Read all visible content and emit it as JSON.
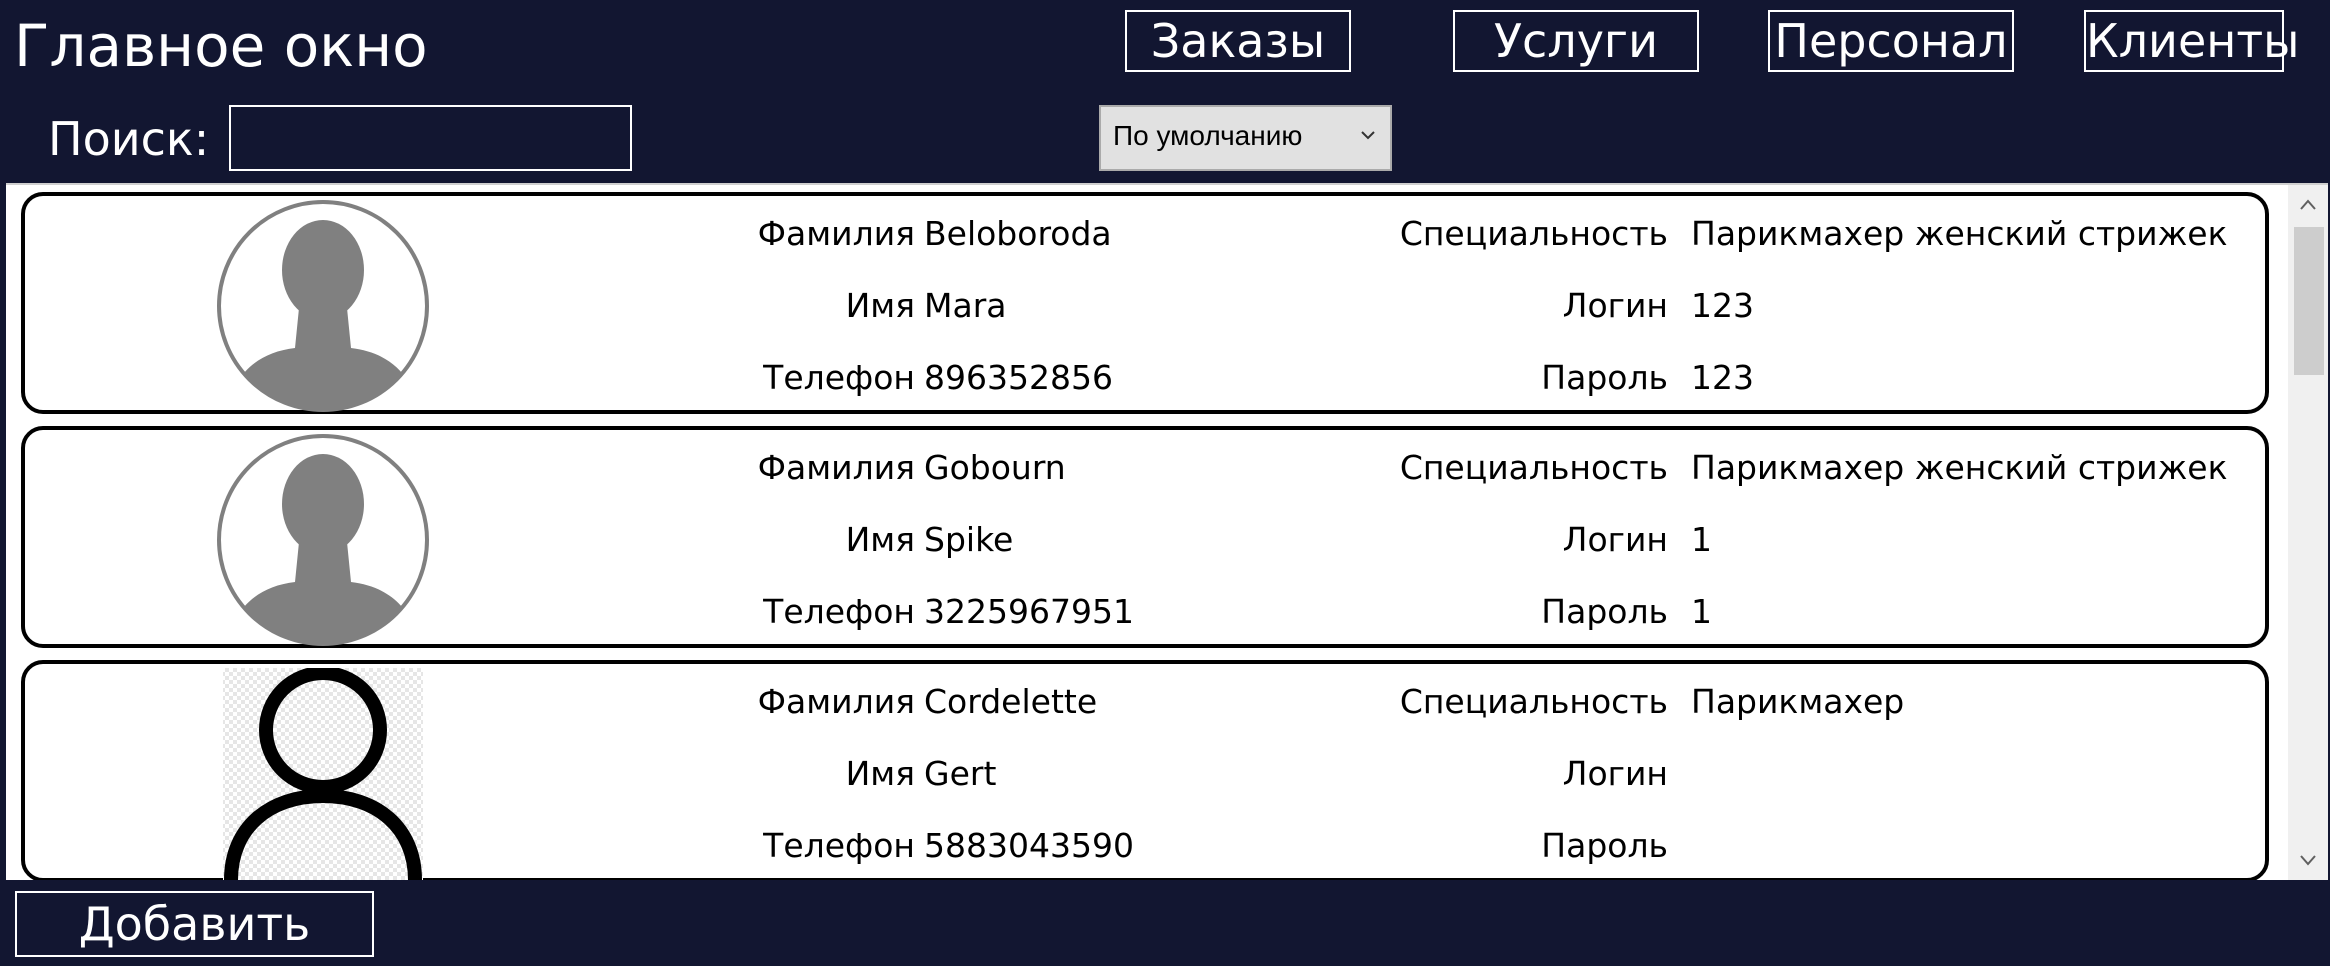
{
  "header": {
    "title": "Главное окно",
    "nav": {
      "orders": "Заказы",
      "services": "Услуги",
      "staff": "Персонал",
      "clients": "Клиенты"
    }
  },
  "search": {
    "label": "Поиск:",
    "value": ""
  },
  "sort": {
    "selected": "По умолчанию"
  },
  "labels": {
    "surname": "Фамилия",
    "name": "Имя",
    "phone": "Телефон",
    "specialty": "Специальность",
    "login": "Логин",
    "password": "Пароль"
  },
  "employees": [
    {
      "surname": "Beloboroda",
      "name": "Mara",
      "phone": "896352856",
      "specialty": "Парикмахер женский стрижек",
      "login": "123",
      "password": "123",
      "avatar_icon": "user-placeholder-icon"
    },
    {
      "surname": "Gobourn",
      "name": "Spike",
      "phone": "3225967951",
      "specialty": "Парикмахер женский стрижек",
      "login": "1",
      "password": "1",
      "avatar_icon": "user-placeholder-icon"
    },
    {
      "surname": "Cordelette",
      "name": "Gert",
      "phone": "5883043590",
      "specialty": "Парикмахер",
      "login": "",
      "password": "",
      "avatar_icon": "user-outline-icon"
    }
  ],
  "footer": {
    "add_label": "Добавить"
  },
  "colors": {
    "background": "#121631",
    "list_background": "#ffffff",
    "avatar_gray": "#808080"
  }
}
